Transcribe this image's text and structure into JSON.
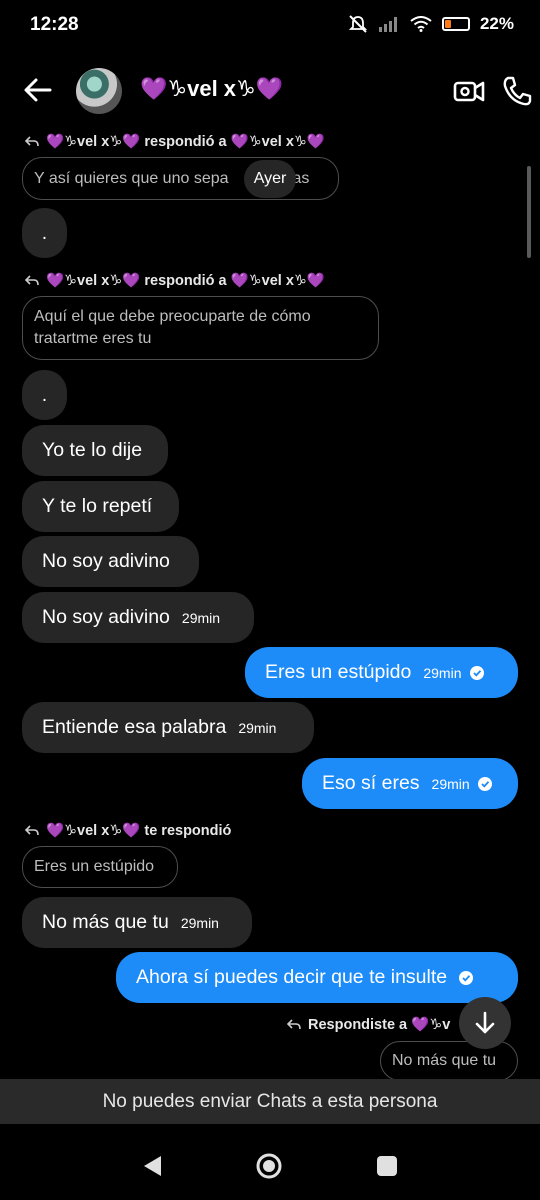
{
  "status_bar": {
    "time": "12:28",
    "battery": "22%",
    "battery_level": 0.22
  },
  "header": {
    "title": "💜♑vel x♑💜"
  },
  "reply_labels": {
    "r1": "💜♑vel x♑💜 respondió a 💜♑vel x♑💜",
    "r2": "💜♑vel x♑💜 respondió a 💜♑vel x♑💜",
    "r3": "💜♑vel x♑💜 te respondió",
    "r4": "Respondiste a 💜♑v"
  },
  "quoted": {
    "q1_part1": "Y así quieres que uno sepa",
    "q1_part2": "sas",
    "q2": "Aquí el que debe preocuparte de cómo tratartme eres tu",
    "q3": "Eres un estúpido",
    "q4": "No más que tu"
  },
  "date_separator": "Ayer",
  "messages": [
    {
      "dir": "in",
      "text": ".",
      "time": ""
    },
    {
      "dir": "in",
      "text": ".",
      "time": ""
    },
    {
      "dir": "in",
      "text": "Yo te lo dije",
      "time": ""
    },
    {
      "dir": "in",
      "text": "Y te lo repetí",
      "time": ""
    },
    {
      "dir": "in",
      "text": "No soy adivino",
      "time": ""
    },
    {
      "dir": "in",
      "text": "No soy adivino",
      "time": "29min"
    },
    {
      "dir": "out",
      "text": "Eres un estúpido",
      "time": "29min"
    },
    {
      "dir": "in",
      "text": "Entiende esa palabra",
      "time": "29min"
    },
    {
      "dir": "out",
      "text": "Eso sí eres",
      "time": "29min"
    },
    {
      "dir": "in",
      "text": "No más que tu",
      "time": "29min"
    },
    {
      "dir": "out",
      "text": "Ahora sí puedes decir que te insulte",
      "time": ""
    }
  ],
  "banner": "No puedes enviar Chats a esta persona",
  "colors": {
    "outgoing": "#1d8cf8",
    "incoming": "#262626",
    "background": "#000000",
    "accent_heart": "#9b4fdc"
  },
  "icons": [
    "back-arrow-icon",
    "video-call-icon",
    "phone-icon",
    "reply-arrow-icon",
    "check-icon",
    "scroll-down-icon",
    "nav-back-icon",
    "nav-home-icon",
    "nav-recents-icon"
  ]
}
